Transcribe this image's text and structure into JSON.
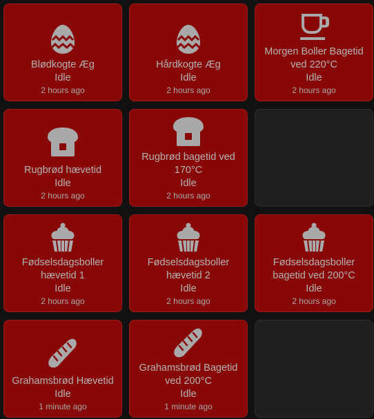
{
  "tiles": [
    {
      "name": "Blødkogte Æg",
      "state": "Idle",
      "last_changed": "2 hours ago",
      "icon": "egg-easter-icon"
    },
    {
      "name": "Hårdkogte Æg",
      "state": "Idle",
      "last_changed": "2 hours ago",
      "icon": "egg-easter-icon"
    },
    {
      "name": "Morgen Boller Bagetid ved 220°C",
      "state": "Idle",
      "last_changed": "2 hours ago",
      "icon": "coffee-cup-icon"
    },
    {
      "name": "Rugbrød hævetid",
      "state": "Idle",
      "last_changed": "2 hours ago",
      "icon": "bread-slice-icon"
    },
    {
      "name": "Rugbrød bagetid ved 170°C",
      "state": "Idle",
      "last_changed": "2 hours ago",
      "icon": "bread-slice-icon"
    },
    {
      "name": "Fødselsdagsboller hævetid 1",
      "state": "Idle",
      "last_changed": "2 hours ago",
      "icon": "cupcake-icon"
    },
    {
      "name": "Fødselsdagsboller hævetid 2",
      "state": "Idle",
      "last_changed": "2 hours ago",
      "icon": "cupcake-icon"
    },
    {
      "name": "Fødselsdagsboller bagetid ved 200°C",
      "state": "Idle",
      "last_changed": "2 hours ago",
      "icon": "cupcake-icon"
    },
    {
      "name": "Grahamsbrød Hævetid",
      "state": "Idle",
      "last_changed": "1 minute ago",
      "icon": "baguette-icon"
    },
    {
      "name": "Grahamsbrød Bagetid ved 200°C",
      "state": "Idle",
      "last_changed": "1 minute ago",
      "icon": "baguette-icon"
    }
  ],
  "colors": {
    "tile_active": "#880808",
    "tile_empty": "#1f1f1f",
    "text": "#b3b3b3",
    "icon": "#a9a9a9",
    "background": "#111111"
  }
}
